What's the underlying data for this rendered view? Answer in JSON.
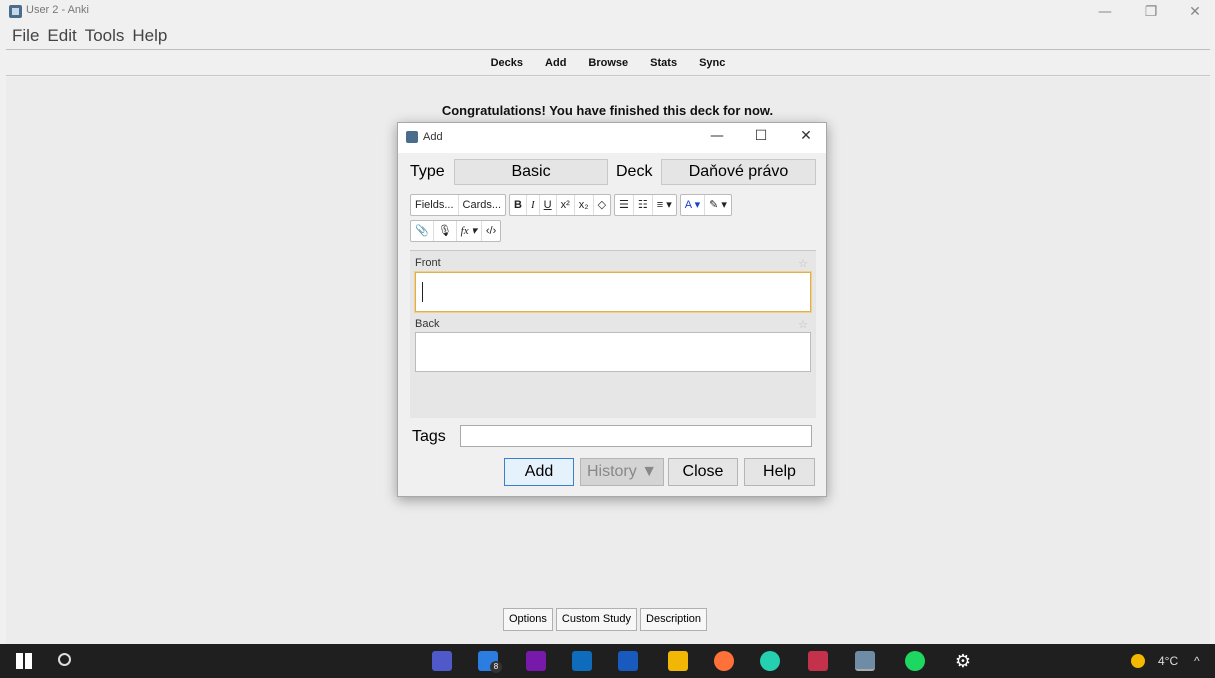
{
  "window": {
    "title": "User 2 - Anki",
    "minimize": "—",
    "maximize": "❐",
    "close": "✕"
  },
  "menu": [
    "File",
    "Edit",
    "Tools",
    "Help"
  ],
  "toolbar": [
    "Decks",
    "Add",
    "Browse",
    "Stats",
    "Sync"
  ],
  "main": {
    "message": "Congratulations! You have finished this deck for now."
  },
  "study_buttons": [
    "Options",
    "Custom Study",
    "Description"
  ],
  "dialog": {
    "title": "Add",
    "type_label": "Type",
    "type_value": "Basic",
    "deck_label": "Deck",
    "deck_value": "Daňové právo",
    "fields_button": "Fields...",
    "cards_button": "Cards...",
    "formatting": {
      "bold": "B",
      "italic": "I",
      "underline": "U",
      "superscript": "x²",
      "subscript": "x₂",
      "eraser": "◇",
      "bullet_list": "☰",
      "numbered_list": "☷",
      "align": "≡ ▾",
      "text_color": "A ▾",
      "highlight": "✎ ▾",
      "attach": "📎",
      "record": "🎙",
      "math": "fx ▾",
      "html": "‹/›"
    },
    "fields": [
      {
        "name": "Front",
        "value": ""
      },
      {
        "name": "Back",
        "value": ""
      }
    ],
    "pin_icon": "☆",
    "tags_label": "Tags",
    "tags_value": "",
    "buttons": {
      "add": "Add",
      "history": "History ▼",
      "close": "Close",
      "help": "Help"
    }
  },
  "taskbar": {
    "mail_badge": "8",
    "weather": "4°C",
    "tray_chevron": "^"
  },
  "colors": {
    "focus_border": "#e0b050",
    "taskbar": "#1f1f1f"
  }
}
